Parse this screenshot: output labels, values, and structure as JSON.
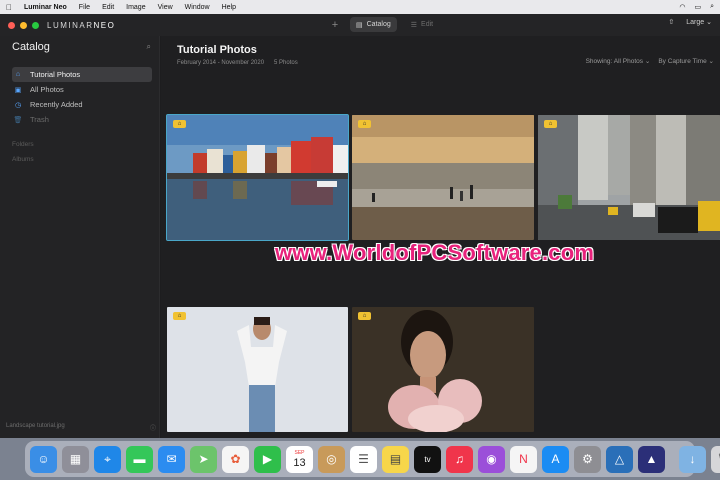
{
  "menubar": {
    "apple_icon": "apple-icon",
    "app_name": "Luminar Neo",
    "items": [
      "File",
      "Edit",
      "Image",
      "View",
      "Window",
      "Help"
    ]
  },
  "titlebar": {
    "brand_prefix": "LUMINAR",
    "brand_suffix": "NEO",
    "tabs": [
      {
        "label": "Catalog",
        "icon": "catalog-icon",
        "active": true
      },
      {
        "label": "Edit",
        "icon": "edit-icon",
        "active": false
      }
    ],
    "size_label": "Large"
  },
  "sidebar": {
    "title": "Catalog",
    "items": [
      {
        "label": "Tutorial Photos",
        "icon": "graduation-cap-icon"
      },
      {
        "label": "All Photos",
        "icon": "photos-icon"
      },
      {
        "label": "Recently Added",
        "icon": "clock-icon"
      },
      {
        "label": "Trash",
        "icon": "trash-icon"
      }
    ],
    "sections": [
      "Folders",
      "Albums"
    ],
    "footer_file": "Landscape tutorial.jpg"
  },
  "gallery": {
    "title": "Tutorial Photos",
    "date_range": "February 2014 - November 2020",
    "count": "5 Photos",
    "showing": "Showing: All Photos",
    "sort": "By Capture Time",
    "badge_icon": "graduation-cap-icon",
    "photos": [
      "harbor-houses",
      "beach-sunset",
      "city-street",
      "portrait-white-shirt",
      "portrait-pink-top"
    ]
  },
  "watermark": "www.WorldofPCSoftware.com",
  "dock": {
    "calendar_month": "SEP",
    "calendar_day": "13",
    "tv_label": "tv",
    "apps": [
      "Finder",
      "Launchpad",
      "Safari",
      "Messages",
      "Mail",
      "Maps",
      "Photos",
      "FaceTime",
      "Calendar",
      "Contacts",
      "Reminders",
      "Notes",
      "TV",
      "Music",
      "Podcasts",
      "News",
      "App Store",
      "System Preferences",
      "Luminar",
      "Luminar Neo",
      "Downloads",
      "Trash"
    ]
  },
  "colors": {
    "accent_blue": "#58a6ff",
    "selection_outline": "#4aa7c9",
    "badge_yellow": "#f1c232",
    "watermark_pink": "#e8227c"
  }
}
